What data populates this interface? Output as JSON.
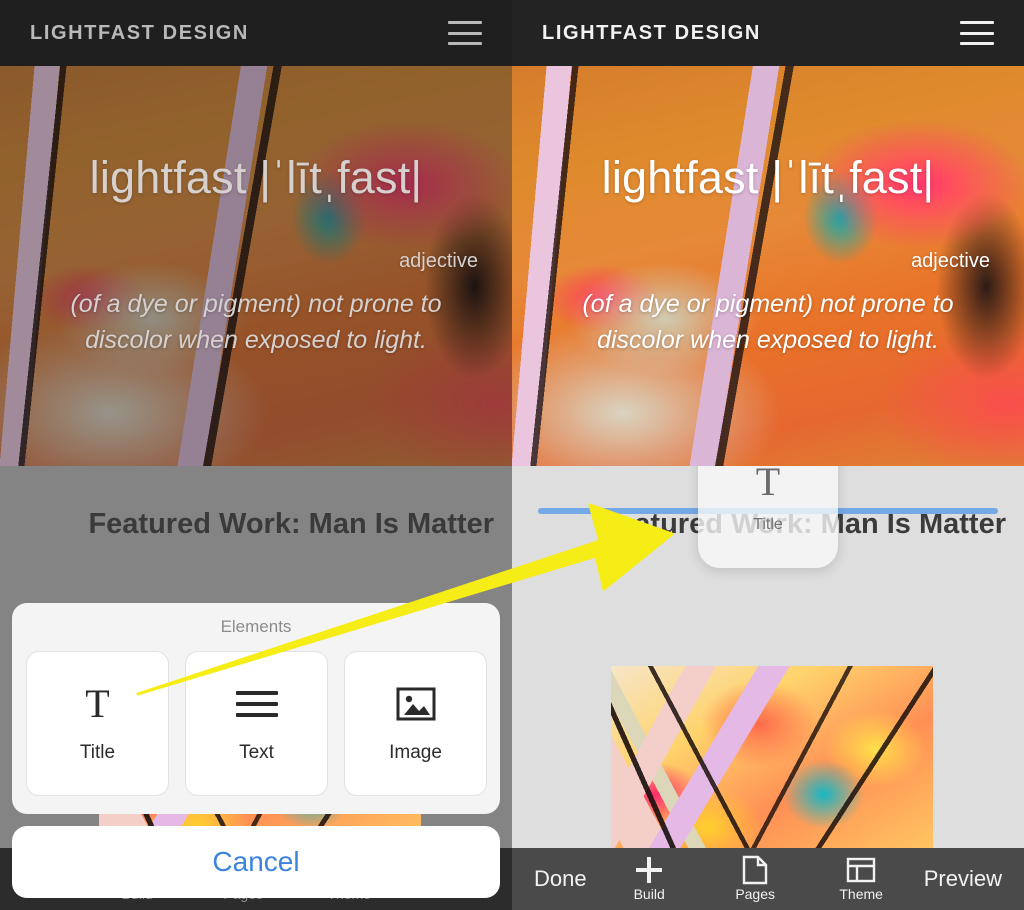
{
  "app": {
    "brand": "LIGHTFAST DESIGN",
    "menu_icon": "hamburger-menu-icon"
  },
  "hero": {
    "word": "lightfast |ˈlītˌfast|",
    "part_of_speech": "adjective",
    "definition": "(of a dye or pigment) not prone to discolor when exposed to light."
  },
  "content": {
    "section_title": "Featured Work: Man Is Matter",
    "image_alt": "abstract-painting-artwork"
  },
  "element_picker": {
    "header": "Elements",
    "cards": [
      {
        "label": "Title",
        "icon": "serif-t-icon"
      },
      {
        "label": "Text",
        "icon": "text-lines-icon"
      },
      {
        "label": "Image",
        "icon": "picture-icon"
      }
    ],
    "cancel_label": "Cancel"
  },
  "drag": {
    "chip_label": "Title",
    "chip_icon": "serif-t-icon",
    "drop_indicator_color": "#74a9e8"
  },
  "toolbar": {
    "done_label": "Done",
    "preview_label": "Preview",
    "items": [
      {
        "label": "Build",
        "icon": "plus-icon"
      },
      {
        "label": "Pages",
        "icon": "document-icon"
      },
      {
        "label": "Theme",
        "icon": "layout-icon"
      }
    ]
  },
  "annotation": {
    "arrow_color": "#f6ec16",
    "arrow_from": "title-element-card",
    "arrow_to": "drop-target-position"
  }
}
